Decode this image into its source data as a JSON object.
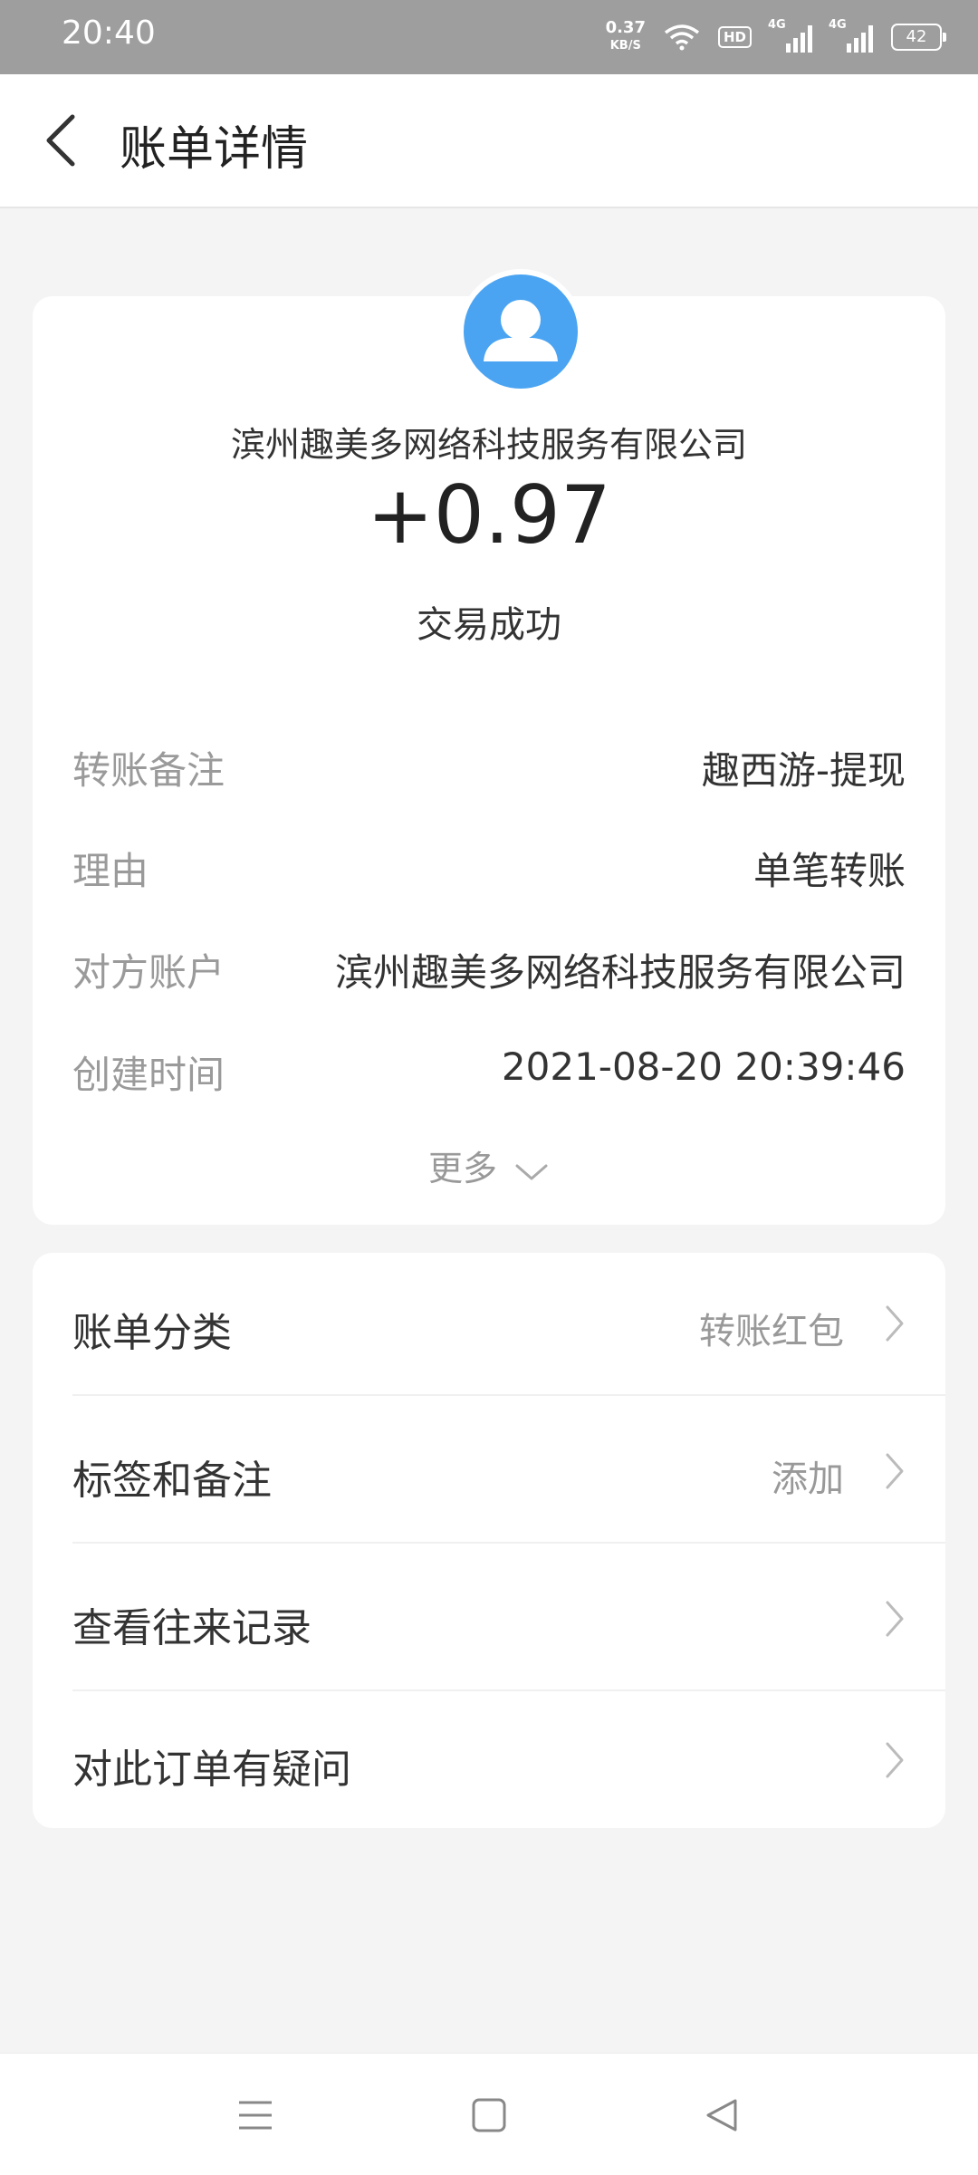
{
  "status_bar": {
    "time": "20:40",
    "net_speed": "0.37",
    "net_speed_unit": "KB/S",
    "hd_label": "HD",
    "signal1_label": "4G",
    "signal2_label": "4G",
    "battery": "42"
  },
  "header": {
    "title": "账单详情"
  },
  "summary": {
    "payer": "滨州趣美多网络科技服务有限公司",
    "amount": "+0.97",
    "status": "交易成功"
  },
  "details": [
    {
      "label": "转账备注",
      "value": "趣西游-提现"
    },
    {
      "label": "理由",
      "value": "单笔转账"
    },
    {
      "label": "对方账户",
      "value": "滨州趣美多网络科技服务有限公司"
    },
    {
      "label": "创建时间",
      "value": "2021-08-20 20:39:46"
    }
  ],
  "more_label": "更多",
  "menu": [
    {
      "label": "账单分类",
      "value": "转账红包"
    },
    {
      "label": "标签和备注",
      "value": "添加"
    },
    {
      "label": "查看往来记录",
      "value": ""
    },
    {
      "label": "对此订单有疑问",
      "value": ""
    }
  ],
  "colors": {
    "status_bar_bg": "#9e9e9e",
    "avatar_bg": "#4aa4f2",
    "page_bg": "#f4f4f4"
  }
}
